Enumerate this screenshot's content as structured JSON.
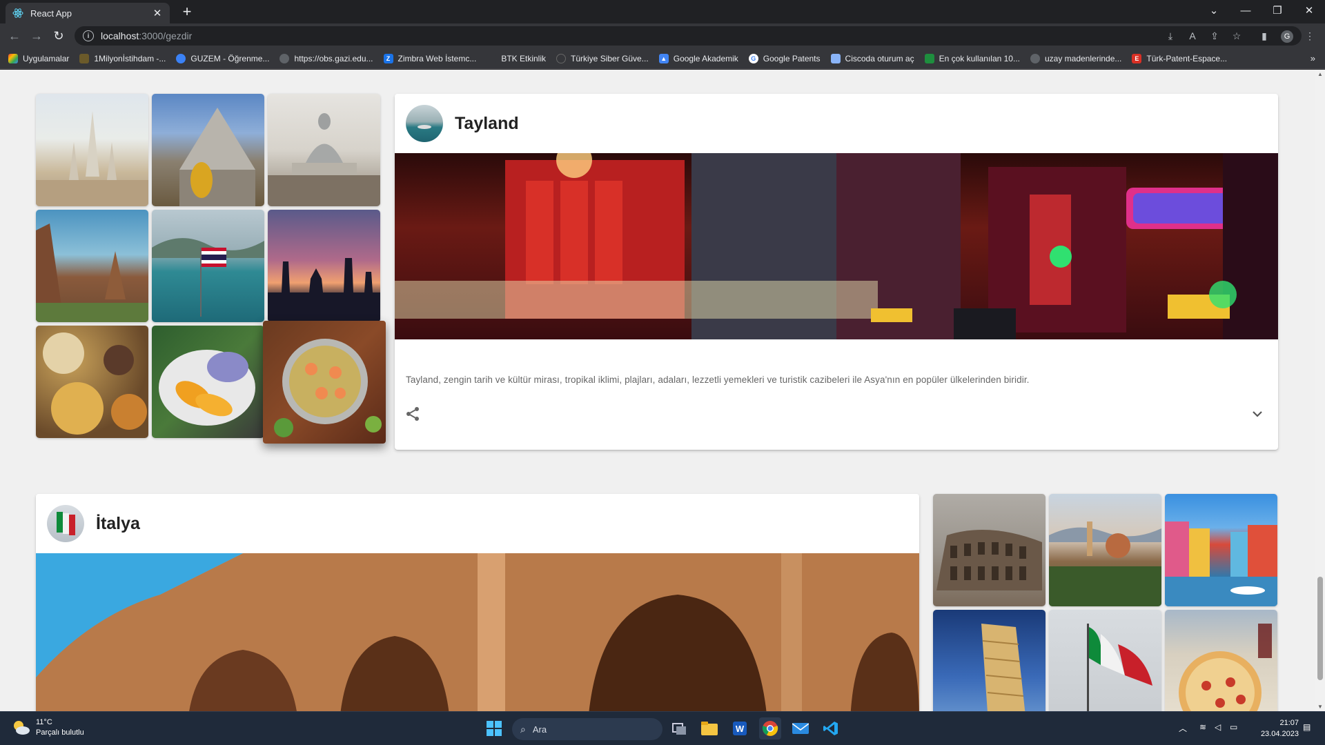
{
  "browser": {
    "tab_title": "React App",
    "url_host": "localhost",
    "url_path": ":3000/gezdir",
    "bookmarks": [
      {
        "label": "Uygulamalar",
        "color": "#e8453c"
      },
      {
        "label": "1Milyonİstihdam -...",
        "color": "#6b5a2a"
      },
      {
        "label": "GUZEM - Öğrenme...",
        "color": "#3b82f6"
      },
      {
        "label": "https://obs.gazi.edu...",
        "color": "#5f6368"
      },
      {
        "label": "Zimbra Web İstemc...",
        "color": "#1a73e8"
      },
      {
        "label": "BTK Etkinlik",
        "color": "#35363a"
      },
      {
        "label": "Türkiye Siber Güve...",
        "color": "#35363a"
      },
      {
        "label": "Google Akademik",
        "color": "#4285f4"
      },
      {
        "label": "Google Patents",
        "color": "#5f6368"
      },
      {
        "label": "Ciscoda oturum aç",
        "color": "#8ab4f8"
      },
      {
        "label": "En çok kullanılan 10...",
        "color": "#1e8e3e"
      },
      {
        "label": "uzay madenlerinde...",
        "color": "#5f6368"
      },
      {
        "label": "Türk-Patent-Espace...",
        "color": "#d93025"
      }
    ]
  },
  "destinations": {
    "thailand": {
      "title": "Tayland",
      "description": "Tayland, zengin tarih ve kültür mirası, tropikal iklimi, plajları, adaları, lezzetli yemekleri ve turistik cazibeleri ile Asya'nın en popüler ülkelerinden biridir.",
      "share_icon": "share-icon",
      "expand_icon": "chevron-down-icon"
    },
    "italy": {
      "title": "İtalya"
    }
  },
  "taskbar": {
    "temperature": "11°C",
    "weather": "Parçalı bulutlu",
    "search_placeholder": "Ara",
    "time": "21:07",
    "date": "23.04.2023"
  }
}
